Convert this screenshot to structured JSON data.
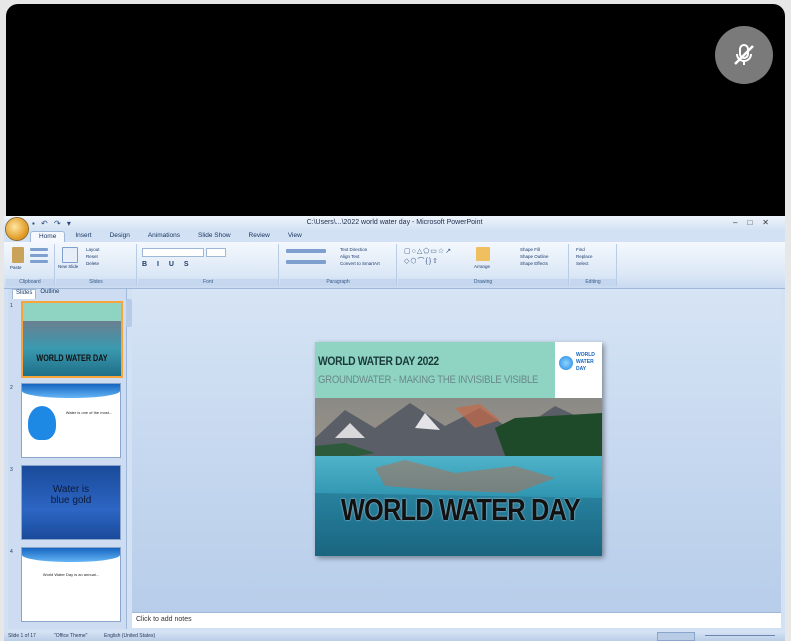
{
  "window": {
    "title": "C:\\Users\\...\\2022 world water day - Microsoft PowerPoint",
    "controls": [
      "–",
      "□",
      "✕"
    ]
  },
  "ribbon": {
    "tabs": [
      "Home",
      "Insert",
      "Design",
      "Animations",
      "Slide Show",
      "Review",
      "View"
    ],
    "groups": [
      "Clipboard",
      "Slides",
      "Font",
      "Paragraph",
      "Drawing",
      "Editing"
    ],
    "buttons": {
      "paste": "Paste",
      "new_slide": "New Slide",
      "layout": "Layout",
      "reset": "Reset",
      "delete": "Delete",
      "text_direction": "Text Direction",
      "align_text": "Align Text",
      "convert_smartart": "Convert to SmartArt",
      "arrange": "Arrange",
      "quick_styles": "Quick Styles",
      "shape_fill": "Shape Fill",
      "shape_outline": "Shape Outline",
      "shape_effects": "Shape Effects",
      "find": "Find",
      "replace": "Replace",
      "select": "Select"
    }
  },
  "panes": {
    "tabs": [
      "Slides",
      "Outline"
    ]
  },
  "thumbnails": [
    {
      "num": "1",
      "text": "WORLD WATER DAY"
    },
    {
      "num": "2",
      "text": "Water is one of the most..."
    },
    {
      "num": "3",
      "text": "Water is blue gold"
    },
    {
      "num": "4",
      "text": "World Water Day is an annual..."
    }
  ],
  "slide": {
    "title": "WORLD WATER DAY 2022",
    "subtitle": "GROUNDWATER - MAKING THE INVISIBLE VISIBLE",
    "big_text": "WORLD WATER DAY",
    "logo_text": [
      "WORLD",
      "WATER",
      "DAY"
    ]
  },
  "notes_placeholder": "Click to add notes",
  "status": {
    "slide": "Slide 1 of 17",
    "theme": "\"Office Theme\"",
    "language": "English (United States)"
  },
  "overlay": {
    "mute_icon": "mic-off-icon"
  },
  "colors": {
    "office_blue": "#d2e1f3",
    "slide_header": "#8fd3c2",
    "selected_thumb": "#f7a53a"
  }
}
